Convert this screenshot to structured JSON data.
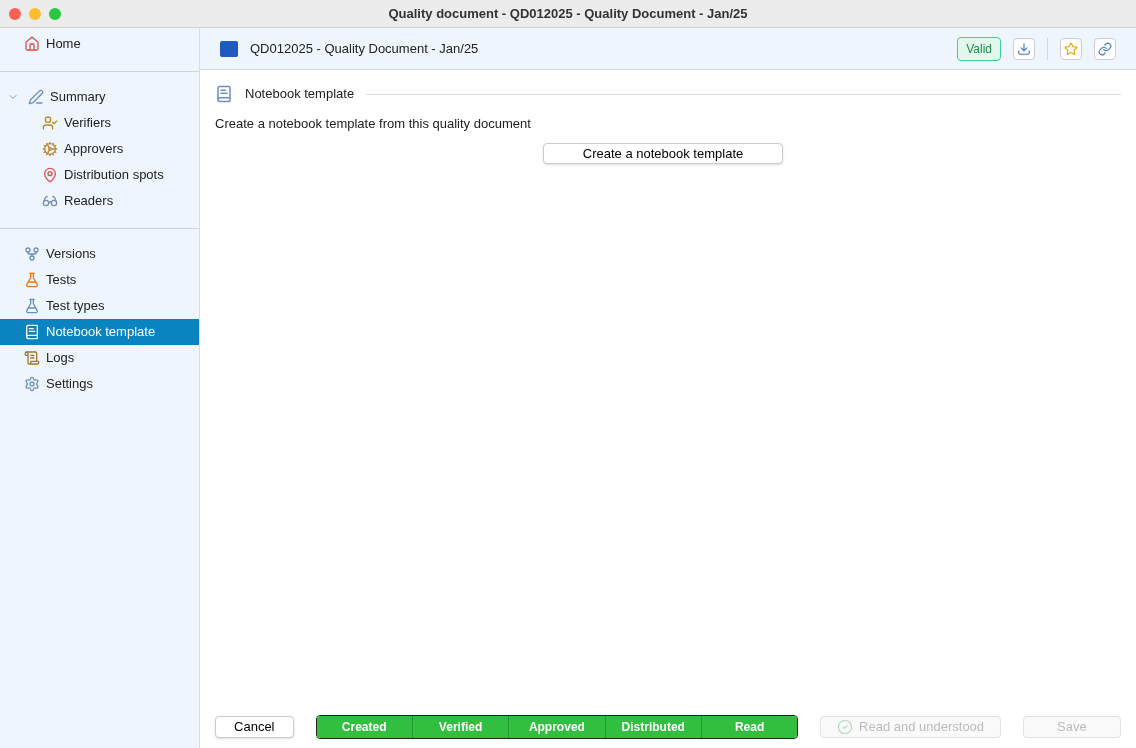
{
  "window": {
    "title": "Quality document - QD012025 - Quality Document - Jan/25"
  },
  "sidebar": {
    "home": {
      "label": "Home",
      "selected": false
    },
    "summary": {
      "label": "Summary",
      "expanded": true,
      "selected": false,
      "children": [
        {
          "label": "Verifiers",
          "selected": false
        },
        {
          "label": "Approvers",
          "selected": false
        },
        {
          "label": "Distribution spots",
          "selected": false
        },
        {
          "label": "Readers",
          "selected": false
        }
      ]
    },
    "items": [
      {
        "label": "Versions",
        "selected": false
      },
      {
        "label": "Tests",
        "selected": false
      },
      {
        "label": "Test types",
        "selected": false
      },
      {
        "label": "Notebook template",
        "selected": true
      },
      {
        "label": "Logs",
        "selected": false
      },
      {
        "label": "Settings",
        "selected": false
      }
    ]
  },
  "header": {
    "title": "QD012025 - Quality Document - Jan/25",
    "status": "Valid"
  },
  "section": {
    "title": "Notebook template",
    "description": "Create a notebook template from this quality document",
    "button": "Create a notebook template"
  },
  "footer": {
    "cancel": "Cancel",
    "stages": [
      {
        "label": "Created",
        "done": true
      },
      {
        "label": "Verified",
        "done": true
      },
      {
        "label": "Approved",
        "done": true
      },
      {
        "label": "Distributed",
        "done": true
      },
      {
        "label": "Read",
        "done": true
      }
    ],
    "read_button": {
      "label": "Read and understood",
      "disabled": true
    },
    "save_button": {
      "label": "Save",
      "disabled": true
    }
  }
}
